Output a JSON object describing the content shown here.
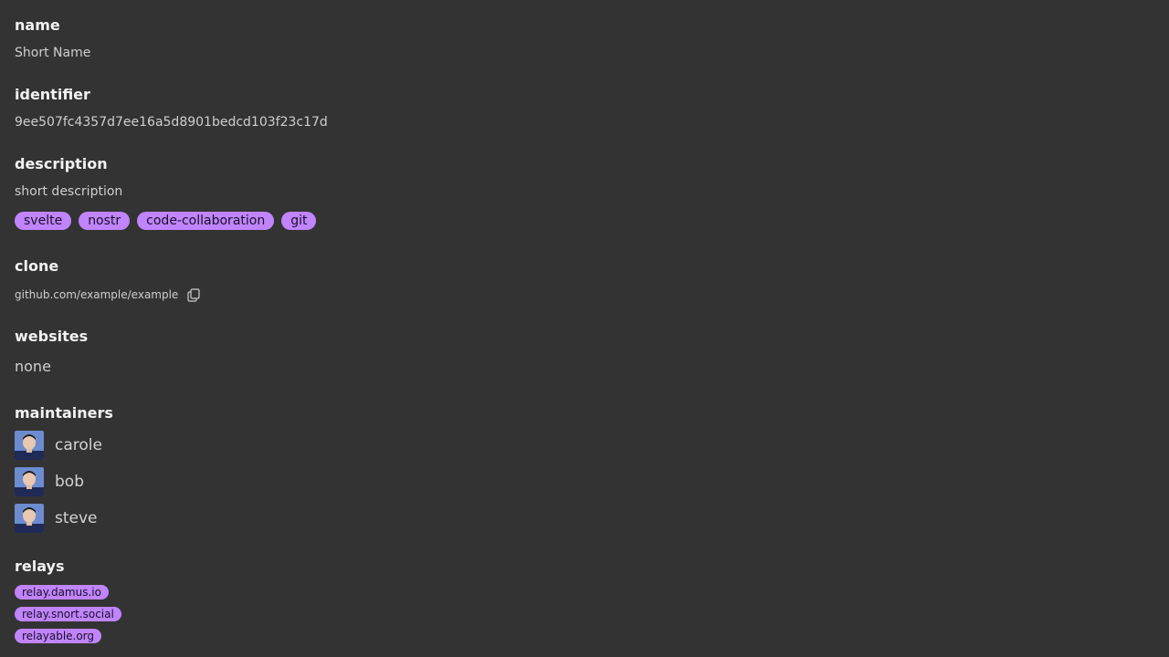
{
  "sections": {
    "name": {
      "heading": "name",
      "value": "Short Name"
    },
    "identifier": {
      "heading": "identifier",
      "value": "9ee507fc4357d7ee16a5d8901bedcd103f23c17d"
    },
    "description": {
      "heading": "description",
      "value": "short description"
    },
    "clone": {
      "heading": "clone",
      "value": "github.com/example/example",
      "copy_icon": "copy-icon"
    },
    "websites": {
      "heading": "websites",
      "value": "none"
    },
    "maintainers": {
      "heading": "maintainers"
    },
    "relays": {
      "heading": "relays"
    }
  },
  "tags": [
    "svelte",
    "nostr",
    "code-collaboration",
    "git"
  ],
  "maintainers": [
    "carole",
    "bob",
    "steve"
  ],
  "relays": [
    "relay.damus.io",
    "relay.snort.social",
    "relayable.org"
  ],
  "colors": {
    "background": "#333333",
    "tag": "#c084fc",
    "tag_text": "#1a1026"
  }
}
